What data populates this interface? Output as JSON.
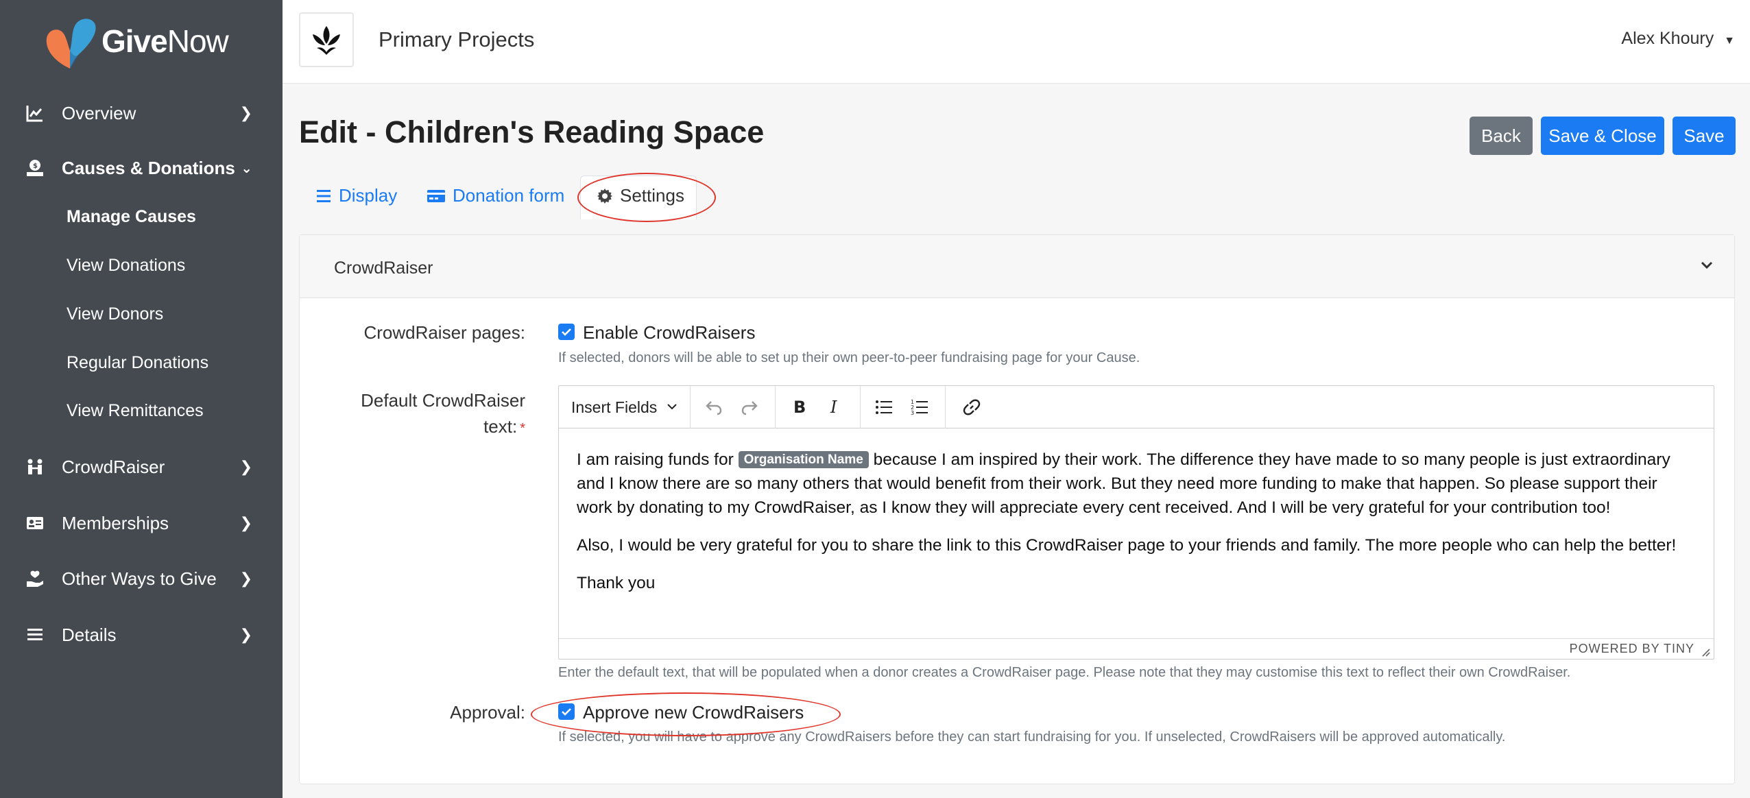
{
  "brand": {
    "name_bold": "Give",
    "name_regular": "Now"
  },
  "sidebar": {
    "items": [
      {
        "label": "Overview",
        "icon": "chart-line-icon"
      },
      {
        "label": "Causes & Donations",
        "icon": "donate-icon",
        "expanded": true
      },
      {
        "label": "CrowdRaiser",
        "icon": "people-icon"
      },
      {
        "label": "Memberships",
        "icon": "id-card-icon"
      },
      {
        "label": "Other Ways to Give",
        "icon": "hand-giving-icon"
      },
      {
        "label": "Details",
        "icon": "list-icon"
      }
    ],
    "sub_items": [
      "Manage Causes",
      "View Donations",
      "View Donors",
      "Regular Donations",
      "View Remittances"
    ]
  },
  "header": {
    "org_name": "Primary Projects",
    "user_name": "Alex Khoury"
  },
  "page": {
    "title": "Edit - Children's Reading Space"
  },
  "actions": {
    "back": "Back",
    "save_close": "Save & Close",
    "save": "Save"
  },
  "tabs": [
    {
      "label": "Display",
      "icon": "list-icon"
    },
    {
      "label": "Donation form",
      "icon": "credit-card-icon"
    },
    {
      "label": "Settings",
      "icon": "gear-icon",
      "active": true
    }
  ],
  "section": {
    "title": "CrowdRaiser",
    "crowdraiser_pages": {
      "label": "CrowdRaiser pages:",
      "checkbox_label": "Enable CrowdRaisers",
      "checked": true,
      "help": "If selected, donors will be able to set up their own peer-to-peer fundraising page for your Cause."
    },
    "default_text": {
      "label_line1": "Default CrowdRaiser",
      "label_line2": "text:",
      "required_mark": "*",
      "toolbar": {
        "insert_fields": "Insert Fields"
      },
      "body": {
        "p1_before": "I am raising funds for ",
        "p1_tag": "Organisation Name",
        "p1_after": " because I am inspired by their work. The difference they have made to so many people is just extraordinary and I know there are so many others that would benefit from their work. But they need more funding to make that happen. So please support their work by donating to my CrowdRaiser, as I know they will appreciate every cent received. And I will be very grateful for your contribution too!",
        "p2": "Also, I would be very grateful for you to share the link to this CrowdRaiser page to your friends and family. The more people who can help the better!",
        "p3": "Thank you"
      },
      "powered_by": "POWERED BY TINY",
      "help": "Enter the default text, that will be populated when a donor creates a CrowdRaiser page. Please note that they may customise this text to reflect their own CrowdRaiser."
    },
    "approval": {
      "label": "Approval:",
      "checkbox_label": "Approve new CrowdRaisers",
      "checked": true,
      "help": "If selected, you will have to approve any CrowdRaisers before they can start fundraising for you. If unselected, CrowdRaisers will be approved automatically."
    }
  },
  "colors": {
    "sidebar_bg": "#454a50",
    "primary": "#1a7bf2",
    "secondary": "#6c757d",
    "annotation": "#e0352b",
    "logo_orange": "#f07d4a",
    "logo_blue": "#3aa0d8"
  }
}
